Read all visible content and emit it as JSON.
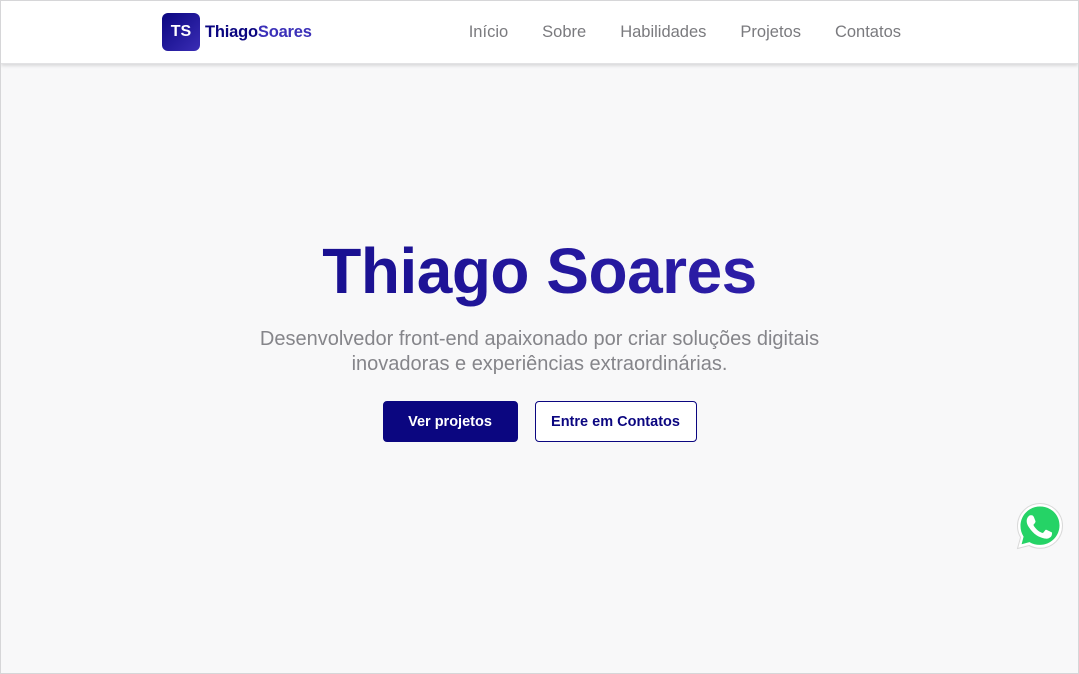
{
  "header": {
    "logo_mark": "TS",
    "logo_first": "Thiago",
    "logo_last": "Soares",
    "nav": [
      "Início",
      "Sobre",
      "Habilidades",
      "Projetos",
      "Contatos"
    ]
  },
  "hero": {
    "title": "Thiago Soares",
    "subtitle": "Desenvolvedor front-end apaixonado por criar soluções digitais inovadoras e experiências extraordinárias.",
    "primary_button": "Ver projetos",
    "secondary_button": "Entre em Contatos"
  },
  "floating": {
    "whatsapp_icon": "whatsapp-icon"
  },
  "colors": {
    "brand": "#0b0680",
    "brand_accent": "#3b30b8",
    "nav_text": "#7a7a7e",
    "subtitle_text": "#85858a",
    "background": "#f8f8f9",
    "whatsapp_green": "#25d366"
  }
}
